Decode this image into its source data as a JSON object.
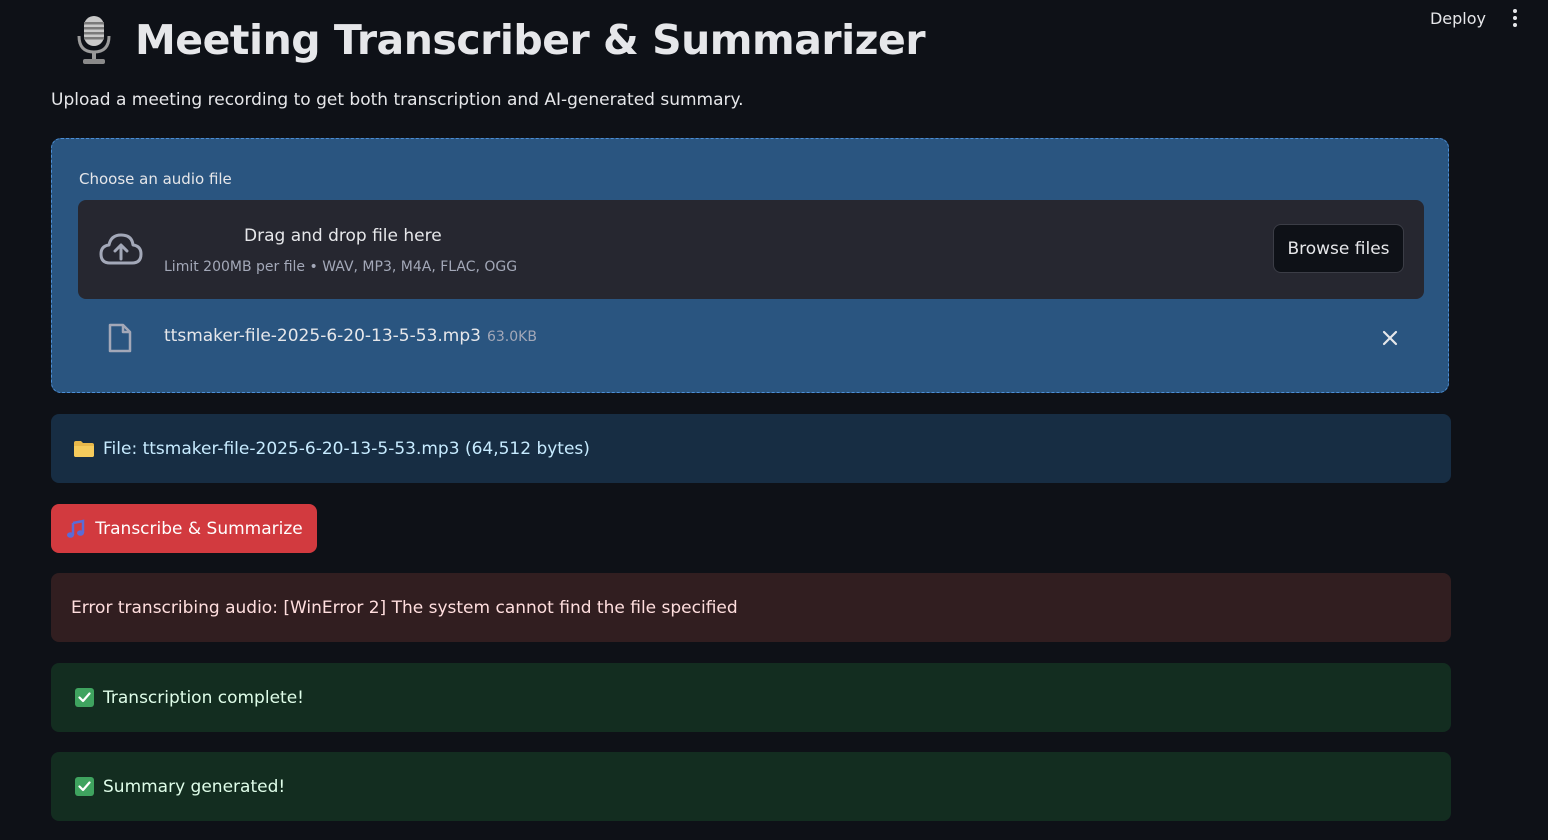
{
  "header": {
    "deploy_label": "Deploy"
  },
  "main": {
    "title": "Meeting Transcriber & Summarizer",
    "subtitle": "Upload a meeting recording to get both transcription and AI-generated summary."
  },
  "uploader": {
    "label": "Choose an audio file",
    "drop_title": "Drag and drop file here",
    "drop_limit": "Limit 200MB per file • WAV, MP3, M4A, FLAC, OGG",
    "browse_label": "Browse files",
    "file": {
      "name": "ttsmaker-file-2025-6-20-13-5-53.mp3",
      "size": "63.0KB"
    }
  },
  "info": {
    "file_text": "File: ttsmaker-file-2025-6-20-13-5-53.mp3 (64,512 bytes)"
  },
  "actions": {
    "run_label": "Transcribe & Summarize"
  },
  "messages": {
    "error": "Error transcribing audio: [WinError 2] The system cannot find the file specified",
    "success_transcription": "Transcription complete!",
    "success_summary": "Summary generated!"
  },
  "icons": {
    "mic": "microphone-icon",
    "cloud": "cloud-upload-icon",
    "file": "file-icon",
    "close": "close-icon",
    "folder": "folder-icon",
    "music": "music-note-icon",
    "check": "check-icon"
  },
  "colors": {
    "background": "#0e1117",
    "uploader_bg": "#2a5580",
    "dropzone_bg": "#262730",
    "info_bg": "#172d43",
    "error_bg": "#311e20",
    "success_bg": "#132d20",
    "primary_button": "#d23a3f"
  }
}
